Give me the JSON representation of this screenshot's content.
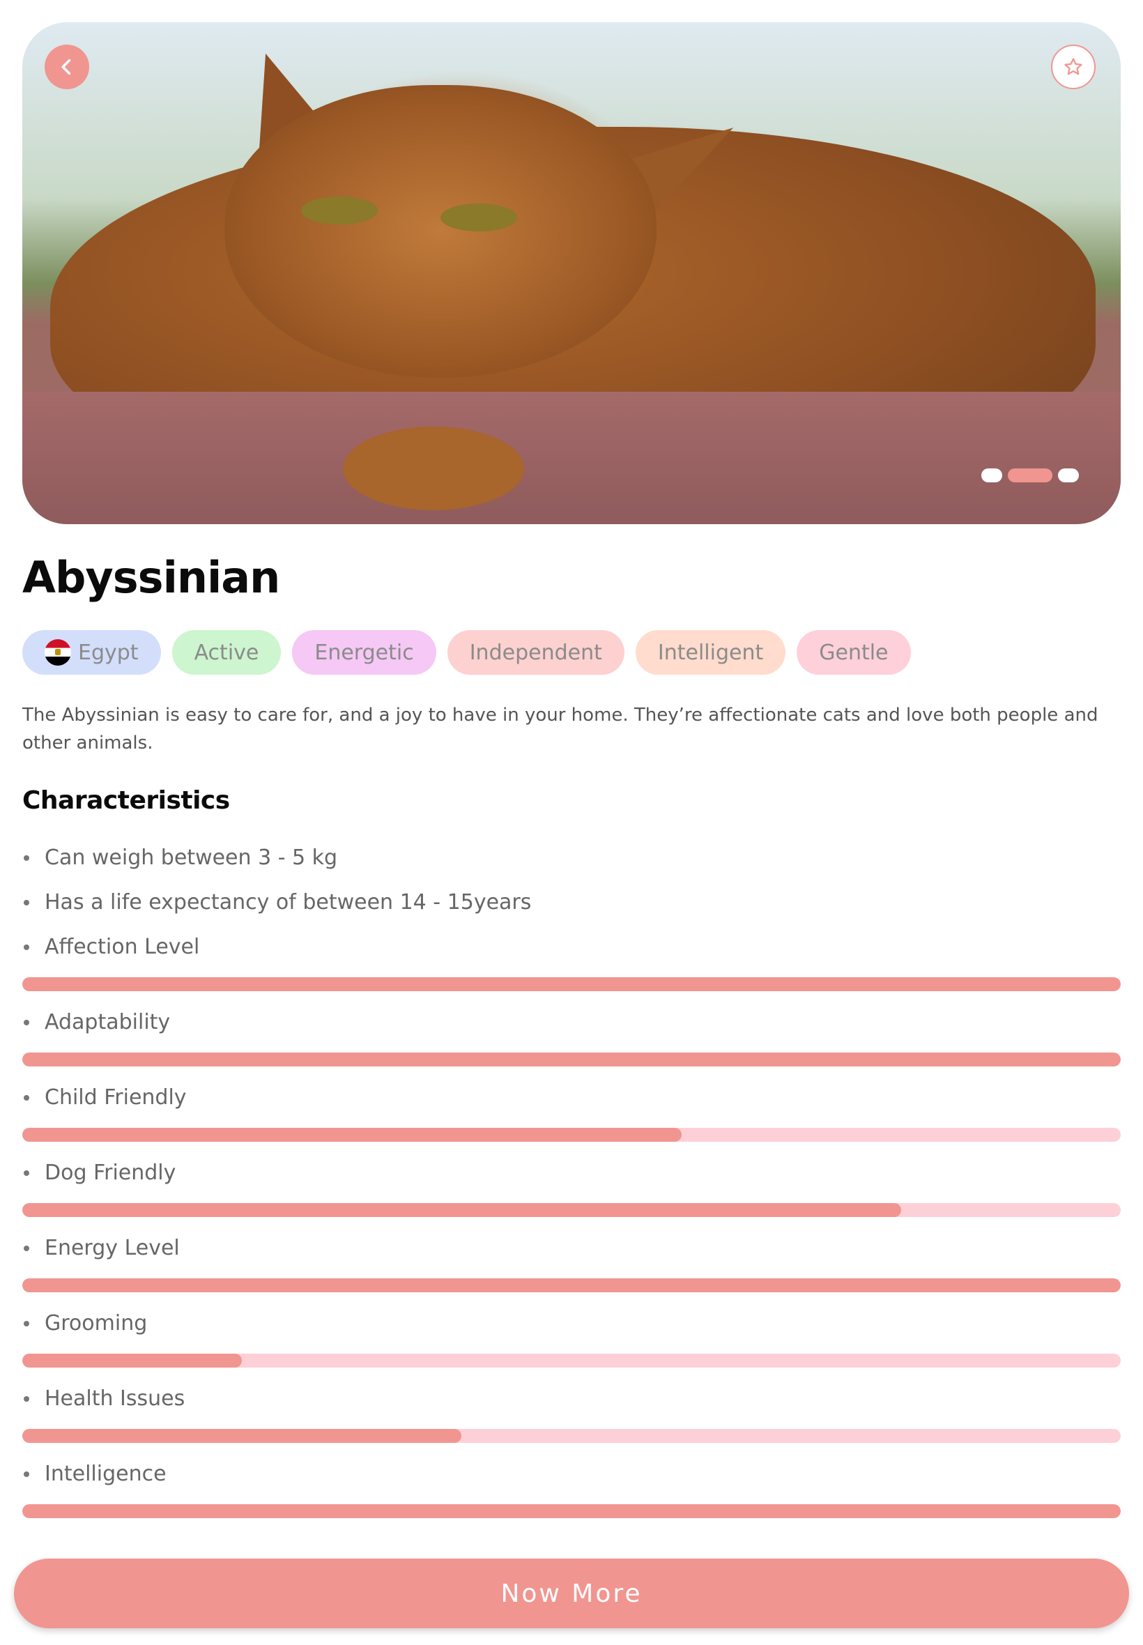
{
  "hero": {
    "image_alt": "",
    "back_icon": "chevron-left-icon",
    "favorite_icon": "star-outline-icon",
    "slide_count": 3,
    "active_slide": 2
  },
  "breed": {
    "name": "Abyssinian",
    "tags": [
      {
        "label": "Egypt",
        "color": "#d3defb",
        "flag": "egypt-flag-icon"
      },
      {
        "label": "Active",
        "color": "#cdf5cf"
      },
      {
        "label": "Energetic",
        "color": "#f5c8f5"
      },
      {
        "label": "Independent",
        "color": "#fcd1d0"
      },
      {
        "label": "Intelligent",
        "color": "#ffdccd"
      },
      {
        "label": "Gentle",
        "color": "#fdd0da"
      }
    ],
    "description": "The Abyssinian is easy to care for, and a joy to have in your home. They’re affectionate cats and love both people and other animals."
  },
  "characteristics": {
    "title": "Characteristics",
    "facts": [
      "Can weigh between 3 - 5 kg",
      "Has a life expectancy of between 14 - 15years"
    ],
    "ratings": [
      {
        "label": "Affection Level",
        "level": 1.0
      },
      {
        "label": "Adaptability",
        "level": 1.0
      },
      {
        "label": "Child Friendly",
        "level": 0.6
      },
      {
        "label": "Dog Friendly",
        "level": 0.8
      },
      {
        "label": "Energy Level",
        "level": 1.0
      },
      {
        "label": "Grooming",
        "level": 0.2
      },
      {
        "label": "Health Issues",
        "level": 0.4
      },
      {
        "label": "Intelligence",
        "level": 1.0
      }
    ]
  },
  "colors": {
    "accent": "#f19590",
    "track": "#fdd0d7"
  },
  "cta": {
    "label": "Now More"
  }
}
